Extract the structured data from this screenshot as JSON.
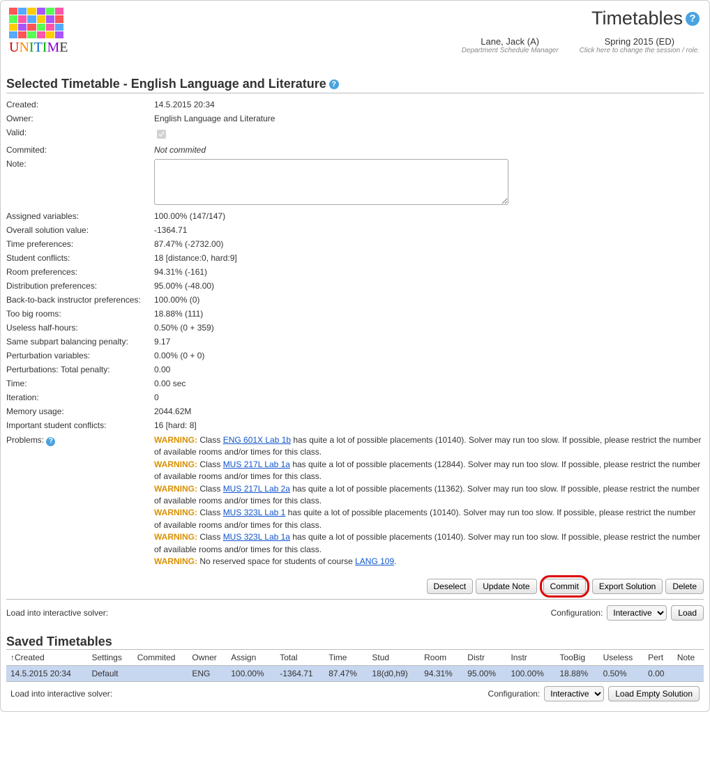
{
  "header": {
    "page_title": "Timetables",
    "user": "Lane, Jack (A)",
    "user_role": "Department Schedule Manager",
    "session": "Spring 2015 (ED)",
    "session_hint": "Click here to change the session / role."
  },
  "selected": {
    "title": "Selected Timetable - English Language and Literature",
    "rows": {
      "created_label": "Created:",
      "created_value": "14.5.2015 20:34",
      "owner_label": "Owner:",
      "owner_value": "English Language and Literature",
      "valid_label": "Valid:",
      "committed_label": "Commited:",
      "committed_value": "Not commited",
      "note_label": "Note:",
      "assigned_label": "Assigned variables:",
      "assigned_value": "100.00% (147/147)",
      "overall_label": "Overall solution value:",
      "overall_value": "-1364.71",
      "timepref_label": "Time preferences:",
      "timepref_value": "87.47% (-2732.00)",
      "stud_label": "Student conflicts:",
      "stud_value": "18 [distance:0, hard:9]",
      "roompref_label": "Room preferences:",
      "roompref_value": "94.31% (-161)",
      "distpref_label": "Distribution preferences:",
      "distpref_value": "95.00% (-48.00)",
      "b2b_label": "Back-to-back instructor preferences:",
      "b2b_value": "100.00% (0)",
      "toobig_label": "Too big rooms:",
      "toobig_value": "18.88% (111)",
      "useless_label": "Useless half-hours:",
      "useless_value": "0.50% (0 + 359)",
      "subpart_label": "Same subpart balancing penalty:",
      "subpart_value": "9.17",
      "pertvar_label": "Perturbation variables:",
      "pertvar_value": "0.00% (0 + 0)",
      "perttot_label": "Perturbations: Total penalty:",
      "perttot_value": "0.00",
      "time_label": "Time:",
      "time_value": "0.00 sec",
      "iter_label": "Iteration:",
      "iter_value": "0",
      "mem_label": "Memory usage:",
      "mem_value": "2044.62M",
      "impstud_label": "Important student conflicts:",
      "impstud_value": "16 [hard: 8]",
      "problems_label": "Problems:"
    },
    "warnings": [
      {
        "warn": "WARNING:",
        "pre": " Class ",
        "link": "ENG 601X Lab 1b",
        "post": " has quite a lot of possible placements (10140). Solver may run too slow. If possible, please restrict the number of available rooms and/or times for this class."
      },
      {
        "warn": "WARNING:",
        "pre": " Class ",
        "link": "MUS 217L Lab 1a",
        "post": " has quite a lot of possible placements (12844). Solver may run too slow. If possible, please restrict the number of available rooms and/or times for this class."
      },
      {
        "warn": "WARNING:",
        "pre": " Class ",
        "link": "MUS 217L Lab 2a",
        "post": " has quite a lot of possible placements (11362). Solver may run too slow. If possible, please restrict the number of available rooms and/or times for this class."
      },
      {
        "warn": "WARNING:",
        "pre": " Class ",
        "link": "MUS 323L Lab 1",
        "post": " has quite a lot of possible placements (10140). Solver may run too slow. If possible, please restrict the number of available rooms and/or times for this class."
      },
      {
        "warn": "WARNING:",
        "pre": " Class ",
        "link": "MUS 323L Lab 1a",
        "post": " has quite a lot of possible placements (10140). Solver may run too slow. If possible, please restrict the number of available rooms and/or times for this class."
      },
      {
        "warn": "WARNING:",
        "pre": " No reserved space for students of course ",
        "link": "LANG 109",
        "post": "."
      }
    ],
    "buttons": {
      "deselect": "Deselect",
      "update_note": "Update Note",
      "commit": "Commit",
      "export": "Export Solution",
      "delete": "Delete"
    },
    "load_label": "Load into interactive solver:",
    "config_label": "Configuration:",
    "config_option": "Interactive",
    "load_btn": "Load"
  },
  "saved": {
    "title": "Saved Timetables",
    "headers": {
      "created": "Created",
      "settings": "Settings",
      "committed": "Commited",
      "owner": "Owner",
      "assign": "Assign",
      "total": "Total",
      "time": "Time",
      "stud": "Stud",
      "room": "Room",
      "distr": "Distr",
      "instr": "Instr",
      "toobig": "TooBig",
      "useless": "Useless",
      "pert": "Pert",
      "note": "Note"
    },
    "row": {
      "created": "14.5.2015 20:34",
      "settings": "Default",
      "committed": "",
      "owner": "ENG",
      "assign": "100.00%",
      "total": "-1364.71",
      "time": "87.47%",
      "stud": "18(d0,h9)",
      "room": "94.31%",
      "distr": "95.00%",
      "instr": "100.00%",
      "toobig": "18.88%",
      "useless": "0.50%",
      "pert": "0.00",
      "note": ""
    },
    "load_label": "Load into interactive solver:",
    "config_label": "Configuration:",
    "config_option": "Interactive",
    "load_empty_btn": "Load Empty Solution"
  }
}
